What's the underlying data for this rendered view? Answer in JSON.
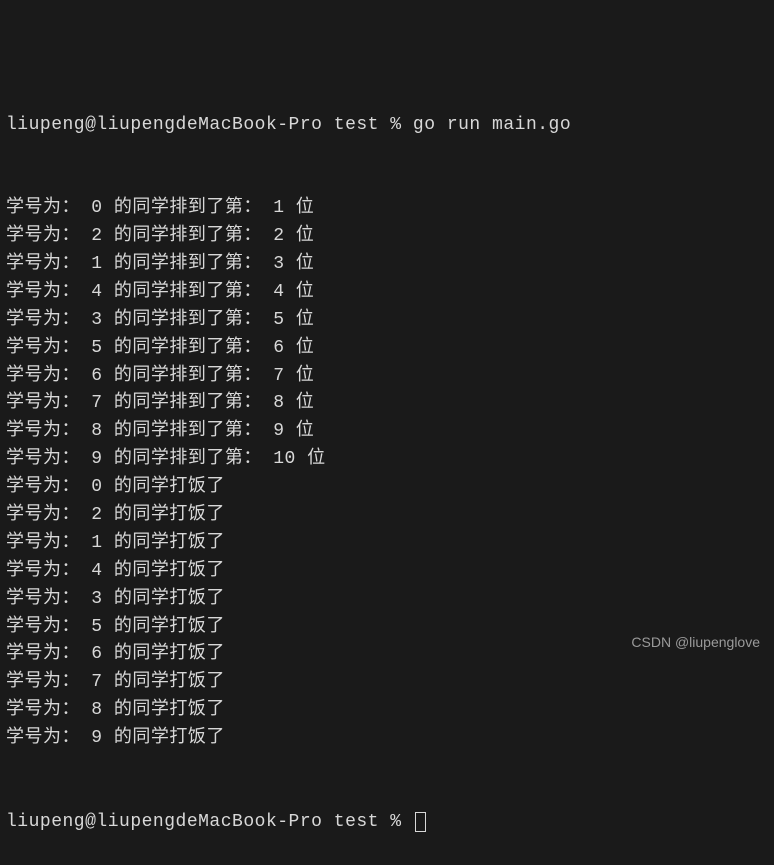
{
  "terminal": {
    "truncated_line": "",
    "prompt_user": "liupeng@liupengdeMacBook-Pro",
    "prompt_dir": "test",
    "prompt_symbol": "%",
    "command": "go run main.go",
    "queue_prefix": "学号为：",
    "queue_mid": " 的同学排到了第：",
    "queue_suffix": " 位",
    "eat_prefix": "学号为：",
    "eat_suffix": " 的同学打饭了",
    "queue_lines": [
      {
        "id": "0",
        "pos": "1"
      },
      {
        "id": "2",
        "pos": "2"
      },
      {
        "id": "1",
        "pos": "3"
      },
      {
        "id": "4",
        "pos": "4"
      },
      {
        "id": "3",
        "pos": "5"
      },
      {
        "id": "5",
        "pos": "6"
      },
      {
        "id": "6",
        "pos": "7"
      },
      {
        "id": "7",
        "pos": "8"
      },
      {
        "id": "8",
        "pos": "9"
      },
      {
        "id": "9",
        "pos": "10"
      }
    ],
    "eat_lines": [
      {
        "id": "0"
      },
      {
        "id": "2"
      },
      {
        "id": "1"
      },
      {
        "id": "4"
      },
      {
        "id": "3"
      },
      {
        "id": "5"
      },
      {
        "id": "6"
      },
      {
        "id": "7"
      },
      {
        "id": "8"
      },
      {
        "id": "9"
      }
    ]
  },
  "watermark": "CSDN @liupenglove"
}
